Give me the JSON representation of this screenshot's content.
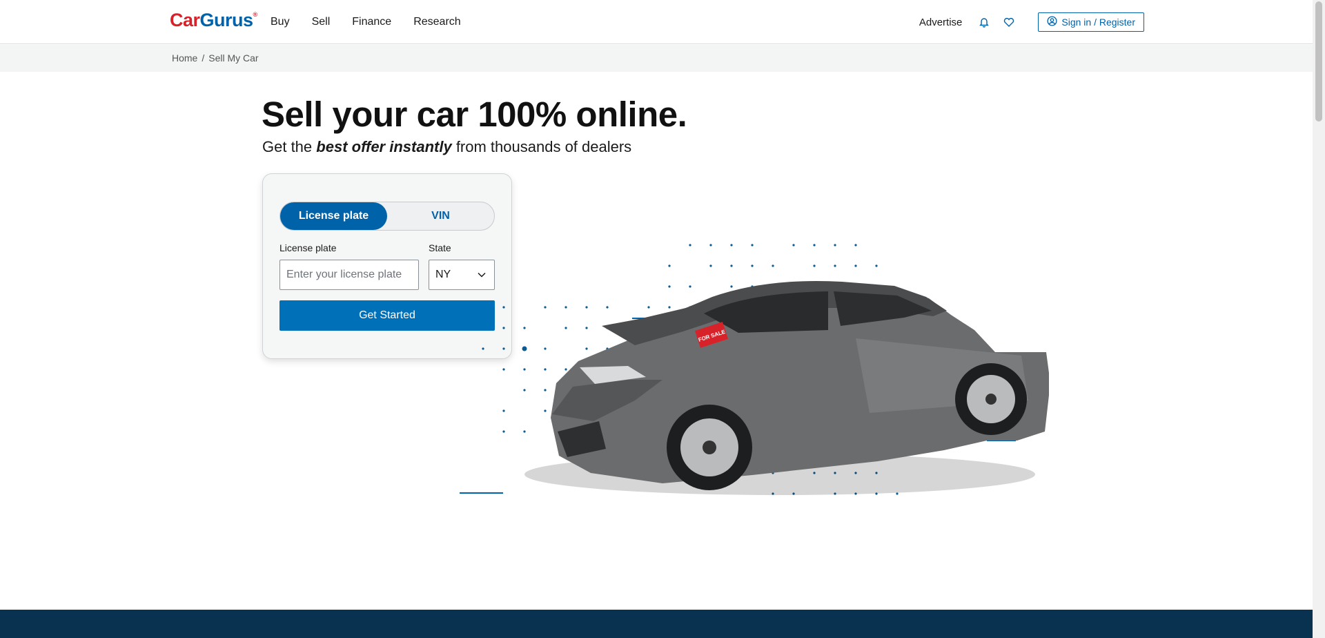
{
  "header": {
    "logo_part1": "Car",
    "logo_part2": "Gurus",
    "logo_mark": "®",
    "nav": [
      "Buy",
      "Sell",
      "Finance",
      "Research"
    ],
    "advertise": "Advertise",
    "signin": "Sign in / Register",
    "icons": [
      "bell-icon",
      "heart-icon",
      "user-circle-icon"
    ]
  },
  "breadcrumb": {
    "home": "Home",
    "separator": "/",
    "current": "Sell My Car"
  },
  "hero": {
    "title": "Sell your car 100% online.",
    "sub_before": "Get the ",
    "sub_emphasis": "best offer instantly",
    "sub_after": " from thousands of dealers"
  },
  "form": {
    "toggle_active": "License plate",
    "toggle_inactive": "VIN",
    "plate_label": "License plate",
    "plate_placeholder": "Enter your license plate",
    "state_label": "State",
    "state_value": "NY",
    "submit": "Get Started"
  },
  "art": {
    "sign_text": "FOR SALE"
  },
  "colors": {
    "brand_blue": "#0062a8",
    "brand_red": "#d8222a",
    "footer_navy": "#08324f"
  }
}
